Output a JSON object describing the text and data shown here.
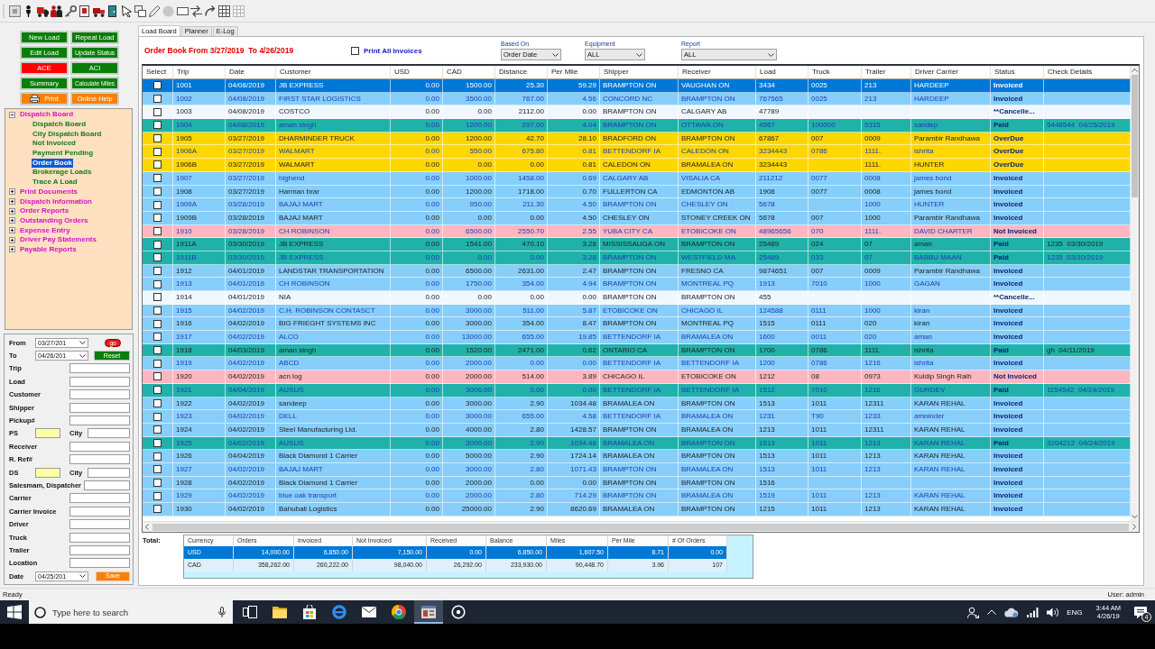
{
  "command_buttons": [
    {
      "label": "New Load",
      "color": "#0a7d0a",
      "kind": "text"
    },
    {
      "label": "Repeat Load",
      "color": "#0a7d0a",
      "kind": "text"
    },
    {
      "label": "Edit Load",
      "color": "#0a7d0a",
      "kind": "text"
    },
    {
      "label": "Update Status",
      "color": "#0a7d0a",
      "kind": "text"
    },
    {
      "label": "ACE",
      "color": "#ff0000",
      "kind": "text"
    },
    {
      "label": "ACI",
      "color": "#0a7d0a",
      "kind": "text"
    },
    {
      "label": "Summary",
      "color": "#0a7d0a",
      "kind": "text"
    },
    {
      "label": "Calculate Miles",
      "color": "#0a7d0a",
      "kind": "text"
    },
    {
      "label": "Print",
      "color": "#ff8000",
      "kind": "icon"
    },
    {
      "label": "Online Help",
      "color": "#ff8000",
      "kind": "text"
    }
  ],
  "tree": [
    {
      "label": "Dispatch Board",
      "expanded": true,
      "selected": false,
      "children": [
        {
          "label": "Dispatch Board",
          "selected": false
        },
        {
          "label": "City Dispatch Board",
          "selected": false
        },
        {
          "label": "Not Invoiced",
          "selected": false
        },
        {
          "label": "Payment Pending",
          "selected": false
        },
        {
          "label": "Order Book",
          "selected": true
        },
        {
          "label": "Brokerage Loads",
          "selected": false
        },
        {
          "label": "Trace A Load",
          "selected": false
        }
      ]
    },
    {
      "label": "Print Documents",
      "expanded": false,
      "selected": false
    },
    {
      "label": "Dispatch Information",
      "expanded": false,
      "selected": false
    },
    {
      "label": "Order Reports",
      "expanded": false,
      "selected": false
    },
    {
      "label": "Outstanding Orders",
      "expanded": false,
      "selected": false
    },
    {
      "label": "Expense Entry",
      "expanded": false,
      "selected": false
    },
    {
      "label": "Driver Pay Statements",
      "expanded": false,
      "selected": false
    },
    {
      "label": "Payable Reports",
      "expanded": false,
      "selected": false
    }
  ],
  "filter_panel": {
    "from": {
      "label": "From",
      "value": "03/27/201"
    },
    "go_button": "go",
    "to": {
      "label": "To",
      "value": "04/26/201"
    },
    "reset_button": "Reset",
    "fields": [
      {
        "label": "Trip",
        "kind": "text"
      },
      {
        "label": "Load",
        "kind": "text"
      },
      {
        "label": "Customer",
        "kind": "text"
      },
      {
        "label": "Shipper",
        "kind": "text"
      },
      {
        "label": "Pickup#",
        "kind": "text"
      },
      {
        "label": "PS",
        "kind": "pair",
        "second_label": "City"
      },
      {
        "label": "Receiver",
        "kind": "text"
      },
      {
        "label": "R. Ref#",
        "kind": "text"
      },
      {
        "label": "DS",
        "kind": "pair",
        "second_label": "City"
      },
      {
        "label": "Salesmam, Dispatcher",
        "kind": "text"
      },
      {
        "label": "Carrier",
        "kind": "text"
      },
      {
        "label": "Carrier Invoice",
        "kind": "text"
      },
      {
        "label": "Driver",
        "kind": "text"
      },
      {
        "label": "Truck",
        "kind": "text"
      },
      {
        "label": "Trailer",
        "kind": "text"
      },
      {
        "label": "Location",
        "kind": "text"
      }
    ],
    "date": {
      "label": "Date",
      "value": "04/25/201"
    },
    "save_button": "Save"
  },
  "tabs": [
    {
      "label": "Load Board",
      "selected": true
    },
    {
      "label": "Planner",
      "selected": false
    },
    {
      "label": "E-Log",
      "selected": false
    }
  ],
  "order_book": {
    "title": "Order Book From 3/27/2019  To 4/26/2019",
    "print_all_invoices": {
      "label": "Print All Invoices",
      "checked": false
    },
    "filters": [
      {
        "label": "Based On",
        "value": "Order Date"
      },
      {
        "label": "Equipment",
        "value": "ALL"
      },
      {
        "label": "Report",
        "value": "ALL"
      }
    ]
  },
  "table": {
    "columns": [
      "Select",
      "Trip",
      "Date",
      "Customer",
      "USD",
      "CAD",
      "Distance",
      "Per Mile",
      "Shipper",
      "Receiver",
      "Load",
      "Truck",
      "Trailer",
      "Driver Carrier",
      "Status",
      "Check Details"
    ],
    "rows": [
      {
        "checked": false,
        "selected": true,
        "trip": "1001",
        "date": "04/08/2019",
        "customer": "JB EXPRESS",
        "usd": "0.00",
        "cad": "1500.00",
        "distance": "25.30",
        "per_mile": "59.29",
        "shipper": "BRAMPTON ON",
        "receiver": "VAUGHAN ON",
        "load": "3434",
        "truck": "0025",
        "trailer": "213",
        "driver_carrier": "HARDEEP",
        "status": "Invoiced"
      },
      {
        "checked": false,
        "selected": false,
        "color": "#87cefa",
        "trip": "1002",
        "date": "04/08/2019",
        "customer": "FIRST STAR LOGISTICS",
        "usd": "0.00",
        "cad": "3500.00",
        "distance": "767.00",
        "per_mile": "4.56",
        "shipper": "CONCORD NC",
        "receiver": "BRAMPTON ON",
        "load": "767565",
        "truck": "0025",
        "trailer": "213",
        "driver_carrier": "HARDEEP",
        "status": "Invoiced"
      },
      {
        "checked": false,
        "selected": false,
        "color": "#f0f8ff",
        "trip": "1003",
        "date": "04/08/2019",
        "customer": "COSTCO",
        "usd": "0.00",
        "cad": "0.00",
        "distance": "2112.00",
        "per_mile": "0.00",
        "shipper": "BRAMPTON ON",
        "receiver": "CALGARY AB",
        "load": "47789",
        "status": "**Cancelle..."
      },
      {
        "checked": false,
        "selected": false,
        "color": "#20b2aa",
        "trip": "1004",
        "date": "04/08/2019",
        "customer": "aman singh",
        "usd": "0.00",
        "cad": "1200.00",
        "distance": "297.00",
        "per_mile": "4.04",
        "shipper": "BRAMPTON ON",
        "receiver": "OTTAWA ON",
        "load": "4567",
        "truck": "100000",
        "trailer": "5315",
        "driver_carrier": "sandep",
        "status": "Paid",
        "check_details": "5448544  04/25/2019"
      },
      {
        "checked": false,
        "selected": false,
        "color": "#ffd700",
        "trip": "1905",
        "date": "03/27/2019",
        "customer": "DHARMINDER TRUCK",
        "usd": "0.00",
        "cad": "1200.00",
        "distance": "42.70",
        "per_mile": "28.10",
        "shipper": "BRADFORD ON",
        "receiver": "BRAMPTON ON",
        "load": "67867",
        "truck": "007",
        "trailer": "0009",
        "driver_carrier": "Parambir Randhawa",
        "status": "OverDue"
      },
      {
        "checked": false,
        "selected": false,
        "color": "#ffd700",
        "trip": "1906A",
        "date": "03/27/2019",
        "customer": "WALMART",
        "usd": "0.00",
        "cad": "550.00",
        "distance": "675.80",
        "per_mile": "0.81",
        "shipper": "BETTENDORF IA",
        "receiver": "CALEDON ON",
        "load": "3234443",
        "truck": "0786",
        "trailer": "1111.",
        "driver_carrier": "ishrita",
        "status": "OverDue"
      },
      {
        "checked": false,
        "selected": false,
        "color": "#ffd700",
        "trip": "1906B",
        "date": "03/27/2019",
        "customer": "WALMART",
        "usd": "0.00",
        "cad": "0.00",
        "distance": "0.00",
        "per_mile": "0.81",
        "shipper": "CALEDON ON",
        "receiver": "BRAMALEA ON",
        "load": "3234443",
        "trailer": "1111.",
        "driver_carrier": "HUNTER",
        "status": "OverDue"
      },
      {
        "checked": false,
        "selected": false,
        "color": "#87cefa",
        "trip": "1907",
        "date": "03/27/2019",
        "customer": "highend",
        "usd": "0.00",
        "cad": "1000.00",
        "distance": "1458.00",
        "per_mile": "0.69",
        "shipper": "CALGARY AB",
        "receiver": "VISALIA CA",
        "load": "211212",
        "truck": "0077",
        "trailer": "0008",
        "driver_carrier": "james bond",
        "status": "Invoiced"
      },
      {
        "checked": false,
        "selected": false,
        "color": "#87cefa",
        "trip": "1908",
        "date": "03/27/2019",
        "customer": "Harman brar",
        "usd": "0.00",
        "cad": "1200.00",
        "distance": "1718.00",
        "per_mile": "0.70",
        "shipper": "FULLERTON CA",
        "receiver": "EDMONTON AB",
        "load": "1908",
        "truck": "0077",
        "trailer": "0008",
        "driver_carrier": "james bond",
        "status": "Invoiced"
      },
      {
        "checked": false,
        "selected": false,
        "color": "#87cefa",
        "trip": "1909A",
        "date": "03/28/2019",
        "customer": "BAJAJ MART",
        "usd": "0.00",
        "cad": "950.00",
        "distance": "211.30",
        "per_mile": "4.50",
        "shipper": "BRAMPTON ON",
        "receiver": "CHESLEY ON",
        "load": "5678",
        "trailer": "1000",
        "driver_carrier": "HUNTER",
        "status": "Invoiced"
      },
      {
        "checked": false,
        "selected": false,
        "color": "#87cefa",
        "trip": "1909B",
        "date": "03/28/2019",
        "customer": "BAJAJ MART",
        "usd": "0.00",
        "cad": "0.00",
        "distance": "0.00",
        "per_mile": "4.50",
        "shipper": "CHESLEY ON",
        "receiver": "STONEY CREEK ON",
        "load": "5678",
        "truck": "007",
        "trailer": "1000",
        "driver_carrier": "Parambir Randhawa",
        "status": "Invoiced"
      },
      {
        "checked": false,
        "selected": false,
        "color": "#ffb6c1",
        "trip": "1910",
        "date": "03/28/2019",
        "customer": "CH ROBINSON",
        "usd": "0.00",
        "cad": "6500.00",
        "distance": "2550.70",
        "per_mile": "2.55",
        "shipper": "YUBA CITY CA",
        "receiver": "ETOBICOKE ON",
        "load": "48965656",
        "truck": "070",
        "trailer": "1111.",
        "driver_carrier": "DAVID CHARTER",
        "status": "Not Invoiced"
      },
      {
        "checked": false,
        "selected": false,
        "color": "#20b2aa",
        "trip": "1911A",
        "date": "03/30/2019",
        "customer": "JB EXPRESS",
        "usd": "0.00",
        "cad": "1541.00",
        "distance": "470.10",
        "per_mile": "3.28",
        "shipper": "MISSISSAUGA ON",
        "receiver": "BRAMPTON ON",
        "load": "25489",
        "truck": "024",
        "trailer": "07",
        "driver_carrier": "aman",
        "status": "Paid",
        "check_details": "1235  03/30/2019"
      },
      {
        "checked": false,
        "selected": false,
        "color": "#20b2aa",
        "trip": "1911B",
        "date": "03/30/2019",
        "customer": "JB EXPRESS",
        "usd": "0.00",
        "cad": "0.00",
        "distance": "0.00",
        "per_mile": "3.28",
        "shipper": "BRAMPTON ON",
        "receiver": "WESTFIELD MA",
        "load": "25489",
        "truck": "033",
        "trailer": "07",
        "driver_carrier": "BABBU MAAN",
        "status": "Paid",
        "check_details": "1235  03/30/2019"
      },
      {
        "checked": false,
        "selected": false,
        "color": "#87cefa",
        "trip": "1912",
        "date": "04/01/2019",
        "customer": "LANDSTAR TRANSPORTATION",
        "usd": "0.00",
        "cad": "6500.00",
        "distance": "2631.00",
        "per_mile": "2.47",
        "shipper": "BRAMPTON ON",
        "receiver": "FRESNO CA",
        "load": "9874651",
        "truck": "007",
        "trailer": "0009",
        "driver_carrier": "Parambir Randhawa",
        "status": "Invoiced"
      },
      {
        "checked": false,
        "selected": false,
        "color": "#87cefa",
        "trip": "1913",
        "date": "04/01/2019",
        "customer": "CH ROBINSON",
        "usd": "0.00",
        "cad": "1750.00",
        "distance": "354.00",
        "per_mile": "4.94",
        "shipper": "BRAMPTON ON",
        "receiver": "MONTREAL PQ",
        "load": "1913",
        "truck": "7010",
        "trailer": "1000",
        "driver_carrier": "GAGAN",
        "status": "Invoiced"
      },
      {
        "checked": false,
        "selected": false,
        "color": "#f0f8ff",
        "trip": "1914",
        "date": "04/01/2019",
        "customer": "NIA",
        "usd": "0.00",
        "cad": "0.00",
        "distance": "0.00",
        "per_mile": "0.00",
        "shipper": "BRAMPTON ON",
        "receiver": "BRAMPTON ON",
        "load": "455",
        "status": "**Cancelle..."
      },
      {
        "checked": false,
        "selected": false,
        "color": "#87cefa",
        "trip": "1915",
        "date": "04/02/2019",
        "customer": "C.H. ROBINSON CONTASCT",
        "usd": "0.00",
        "cad": "3000.00",
        "distance": "511.00",
        "per_mile": "5.87",
        "shipper": "ETOBICOKE ON",
        "receiver": "CHICAGO IL",
        "load": "124588",
        "truck": "0111",
        "trailer": "1000",
        "driver_carrier": "kiran",
        "status": "Invoiced"
      },
      {
        "checked": false,
        "selected": false,
        "color": "#87cefa",
        "trip": "1916",
        "date": "04/02/2019",
        "customer": "BIG FRIEGHT SYSTEMS INC",
        "usd": "0.00",
        "cad": "3000.00",
        "distance": "354.00",
        "per_mile": "8.47",
        "shipper": "BRAMPTON ON",
        "receiver": "MONTREAL PQ",
        "load": "1515",
        "truck": "0111",
        "trailer": "020",
        "driver_carrier": "kiran",
        "status": "Invoiced"
      },
      {
        "checked": false,
        "selected": false,
        "color": "#87cefa",
        "trip": "1917",
        "date": "04/02/2019",
        "customer": "ALCO",
        "usd": "0.00",
        "cad": "13000.00",
        "distance": "655.00",
        "per_mile": "19.85",
        "shipper": "BETTENDORF IA",
        "receiver": "BRAMALEA ON",
        "load": "1600",
        "truck": "0011",
        "trailer": "020",
        "driver_carrier": "aman",
        "status": "Invoiced"
      },
      {
        "checked": false,
        "selected": false,
        "color": "#20b2aa",
        "trip": "1918",
        "date": "04/03/2019",
        "customer": "aman singh",
        "usd": "0.00",
        "cad": "1520.00",
        "distance": "2471.00",
        "per_mile": "0.62",
        "shipper": "ONTARIO CA",
        "receiver": "BRAMPTON ON",
        "load": "1700",
        "truck": "0786",
        "trailer": "1111.",
        "driver_carrier": "ishrita",
        "status": "Paid",
        "check_details": "gh  04/11/2019"
      },
      {
        "checked": false,
        "selected": false,
        "color": "#87cefa",
        "trip": "1919",
        "date": "04/02/2019",
        "customer": "ABCD",
        "usd": "0.00",
        "cad": "2000.00",
        "distance": "0.00",
        "per_mile": "0.00",
        "shipper": "BETTENDORF IA",
        "receiver": "BETTENDORF IA",
        "load": "1200",
        "truck": "0786",
        "trailer": "1216",
        "driver_carrier": "ishrita",
        "status": "Invoiced"
      },
      {
        "checked": false,
        "selected": false,
        "color": "#ffb6c1",
        "trip": "1920",
        "date": "04/02/2019",
        "customer": "acn log",
        "usd": "0.00",
        "cad": "2000.00",
        "distance": "514.00",
        "per_mile": "3.89",
        "shipper": "CHICAGO IL",
        "receiver": "ETOBICOKE ON",
        "load": "1212",
        "truck": "08",
        "trailer": "0973",
        "driver_carrier": "Kuldip Singh Ralh",
        "status": "Not Invoiced"
      },
      {
        "checked": false,
        "selected": false,
        "color": "#20b2aa",
        "trip": "1921",
        "date": "04/04/2019",
        "customer": "AUSUS",
        "usd": "0.00",
        "cad": "3006.00",
        "distance": "0.00",
        "per_mile": "0.00",
        "shipper": "BETTENDORF IA",
        "receiver": "BETTENDORF IA",
        "load": "1512",
        "truck": "7010",
        "trailer": "1216",
        "driver_carrier": "GURDEV",
        "status": "Paid",
        "check_details": "1154542  04/24/2019"
      },
      {
        "checked": false,
        "selected": false,
        "color": "#87cefa",
        "trip": "1922",
        "date": "04/02/2019",
        "customer": "sandeep",
        "usd": "0.00",
        "cad": "3000.00",
        "distance": "2.90",
        "per_mile": "1034.48",
        "shipper": "BRAMALEA ON",
        "receiver": "BRAMPTON ON",
        "load": "1513",
        "truck": "1011",
        "trailer": "12311",
        "driver_carrier": "KARAN REHAL",
        "status": "Invoiced"
      },
      {
        "checked": false,
        "selected": false,
        "color": "#87cefa",
        "trip": "1923",
        "date": "04/02/2019",
        "customer": "DELL",
        "usd": "0.00",
        "cad": "3000.00",
        "distance": "655.00",
        "per_mile": "4.58",
        "shipper": "BETTENDORF IA",
        "receiver": "BRAMALEA ON",
        "load": "1231",
        "truck": "T90",
        "trailer": "1233",
        "driver_carrier": "amninder",
        "status": "Invoiced"
      },
      {
        "checked": false,
        "selected": false,
        "color": "#87cefa",
        "trip": "1924",
        "date": "04/02/2019",
        "customer": "Steel Manufacturing Ltd.",
        "usd": "0.00",
        "cad": "4000.00",
        "distance": "2.80",
        "per_mile": "1428.57",
        "shipper": "BRAMPTON ON",
        "receiver": "BRAMALEA ON",
        "load": "1213",
        "truck": "1011",
        "trailer": "12311",
        "driver_carrier": "KARAN REHAL",
        "status": "Invoiced"
      },
      {
        "checked": false,
        "selected": false,
        "color": "#20b2aa",
        "trip": "1925",
        "date": "04/02/2019",
        "customer": "AUSUS",
        "usd": "0.00",
        "cad": "3000.00",
        "distance": "2.90",
        "per_mile": "1034.48",
        "shipper": "BRAMALEA ON",
        "receiver": "BRAMPTON ON",
        "load": "1513",
        "truck": "1011",
        "trailer": "1213",
        "driver_carrier": "KARAN REHAL",
        "status": "Paid",
        "check_details": "3204212  04/24/2019"
      },
      {
        "checked": false,
        "selected": false,
        "color": "#87cefa",
        "trip": "1926",
        "date": "04/04/2019",
        "customer": "Black Diamond 1 Carrier",
        "usd": "0.00",
        "cad": "5000.00",
        "distance": "2.90",
        "per_mile": "1724.14",
        "shipper": "BRAMALEA ON",
        "receiver": "BRAMPTON ON",
        "load": "1513",
        "truck": "1011",
        "trailer": "1213",
        "driver_carrier": "KARAN REHAL",
        "status": "Invoiced"
      },
      {
        "checked": false,
        "selected": false,
        "color": "#87cefa",
        "trip": "1927",
        "date": "04/02/2019",
        "customer": "BAJAJ MART",
        "usd": "0.00",
        "cad": "3000.00",
        "distance": "2.80",
        "per_mile": "1071.43",
        "shipper": "BRAMPTON ON",
        "receiver": "BRAMALEA ON",
        "load": "1513",
        "truck": "1011",
        "trailer": "1213",
        "driver_carrier": "KARAN REHAL",
        "status": "Invoiced"
      },
      {
        "checked": false,
        "selected": false,
        "color": "#87cefa",
        "trip": "1928",
        "date": "04/02/2019",
        "customer": "Black Diamond 1 Carrier",
        "usd": "0.00",
        "cad": "2000.00",
        "distance": "0.00",
        "per_mile": "0.00",
        "shipper": "BRAMPTON ON",
        "receiver": "BRAMPTON ON",
        "load": "1516",
        "status": "Invoiced"
      },
      {
        "checked": false,
        "selected": false,
        "color": "#87cefa",
        "trip": "1929",
        "date": "04/02/2019",
        "customer": "blue oak transport",
        "usd": "0.00",
        "cad": "2000.00",
        "distance": "2.80",
        "per_mile": "714.29",
        "shipper": "BRAMPTON ON",
        "receiver": "BRAMALEA ON",
        "load": "1519",
        "truck": "1011",
        "trailer": "1213",
        "driver_carrier": "KARAN REHAL",
        "status": "Invoiced"
      },
      {
        "checked": false,
        "selected": false,
        "color": "#87cefa",
        "trip": "1930",
        "date": "04/02/2019",
        "customer": "Bahubali Logistics",
        "usd": "0.00",
        "cad": "25000.00",
        "distance": "2.90",
        "per_mile": "8620.69",
        "shipper": "BRAMALEA ON",
        "receiver": "BRAMPTON ON",
        "load": "1215",
        "truck": "1011",
        "trailer": "1213",
        "driver_carrier": "KARAN REHAL",
        "status": "Invoiced"
      }
    ]
  },
  "totals": {
    "label": "Total:",
    "columns": [
      "Currency",
      "Orders",
      "Invoiced",
      "Not Invoiced",
      "Received",
      "Balance",
      "Miles",
      "Per Mile",
      "# Of Orders"
    ],
    "rows": [
      {
        "selected": true,
        "cells": [
          "USD",
          "14,000.00",
          "6,850.00",
          "7,150.00",
          "0.00",
          "6,850.00",
          "1,607.50",
          "8.71",
          "0.00"
        ]
      },
      {
        "selected": false,
        "cells": [
          "CAD",
          "358,262.00",
          "260,222.00",
          "98,040.00",
          "26,292.00",
          "233,930.00",
          "90,448.70",
          "3.96",
          "107"
        ]
      }
    ]
  },
  "status_bar": {
    "message": "Ready",
    "user": "User: admin"
  },
  "taskbar": {
    "search": {
      "placeholder": "Type here to search"
    },
    "apps": [
      {
        "kind": "task-view",
        "selected": false
      },
      {
        "kind": "folder",
        "selected": false
      },
      {
        "kind": "bag",
        "selected": false
      },
      {
        "kind": "ring-bar",
        "selected": false
      },
      {
        "kind": "envelope",
        "selected": false
      },
      {
        "kind": "tricolor",
        "selected": false
      },
      {
        "kind": "app-window",
        "selected": true
      },
      {
        "kind": "ring",
        "selected": false
      }
    ],
    "language": "ENG",
    "time": "3:44 AM",
    "date": "4/26/19",
    "notification_count": "4"
  }
}
